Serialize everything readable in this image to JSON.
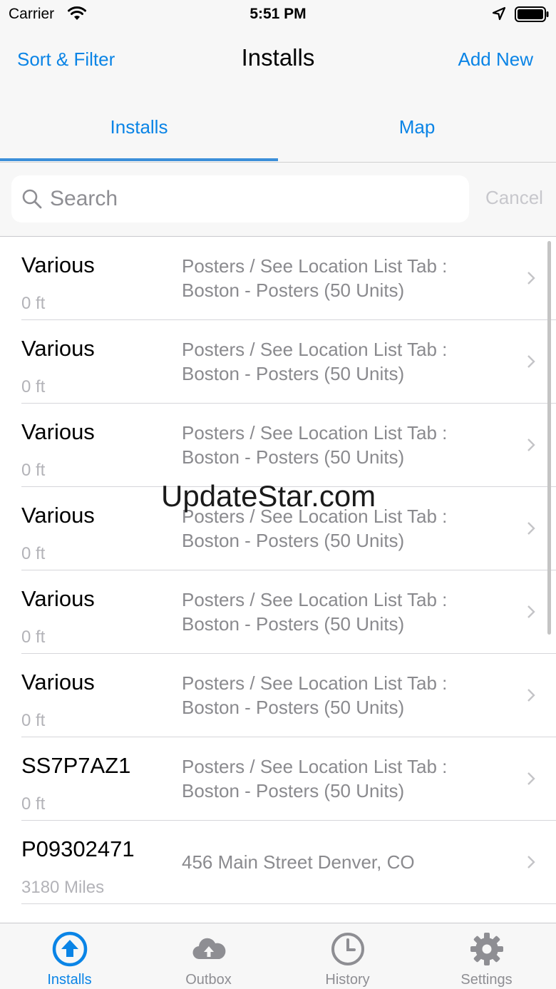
{
  "status_bar": {
    "carrier": "Carrier",
    "time": "5:51 PM"
  },
  "nav": {
    "left_label": "Sort & Filter",
    "title": "Installs",
    "right_label": "Add New"
  },
  "segments": [
    {
      "label": "Installs",
      "selected": true
    },
    {
      "label": "Map",
      "selected": false
    }
  ],
  "search": {
    "placeholder": "Search",
    "value": "",
    "cancel_label": "Cancel"
  },
  "rows": [
    {
      "id": "Various",
      "distance": "0 ft",
      "desc_line1": "Posters / See Location List Tab :",
      "desc_line2": "Boston - Posters (50 Units)"
    },
    {
      "id": "Various",
      "distance": "0 ft",
      "desc_line1": "Posters / See Location List Tab :",
      "desc_line2": "Boston - Posters (50 Units)"
    },
    {
      "id": "Various",
      "distance": "0 ft",
      "desc_line1": "Posters / See Location List Tab :",
      "desc_line2": "Boston - Posters (50 Units)"
    },
    {
      "id": "Various",
      "distance": "0 ft",
      "desc_line1": "Posters / See Location List Tab :",
      "desc_line2": "Boston - Posters (50 Units)"
    },
    {
      "id": "Various",
      "distance": "0 ft",
      "desc_line1": "Posters / See Location List Tab :",
      "desc_line2": "Boston - Posters (50 Units)"
    },
    {
      "id": "Various",
      "distance": "0 ft",
      "desc_line1": "Posters / See Location List Tab :",
      "desc_line2": "Boston - Posters (50 Units)"
    },
    {
      "id": "SS7P7AZ1",
      "distance": "0 ft",
      "desc_line1": "Posters / See Location List Tab :",
      "desc_line2": "Boston - Posters (50 Units)"
    },
    {
      "id": "P09302471",
      "distance": "3180 Miles",
      "desc_line1": "456 Main Street Denver, CO",
      "desc_line2": ""
    }
  ],
  "watermark": "UpdateStar.com",
  "tabs": [
    {
      "label": "Installs",
      "icon": "upload-circle-icon",
      "active": true
    },
    {
      "label": "Outbox",
      "icon": "cloud-upload-icon",
      "active": false
    },
    {
      "label": "History",
      "icon": "clock-icon",
      "active": false
    },
    {
      "label": "Settings",
      "icon": "gear-icon",
      "active": false
    }
  ],
  "colors": {
    "accent": "#0a84e6",
    "inactive": "#8e8e93",
    "secondary_text": "#8a8a8e"
  }
}
